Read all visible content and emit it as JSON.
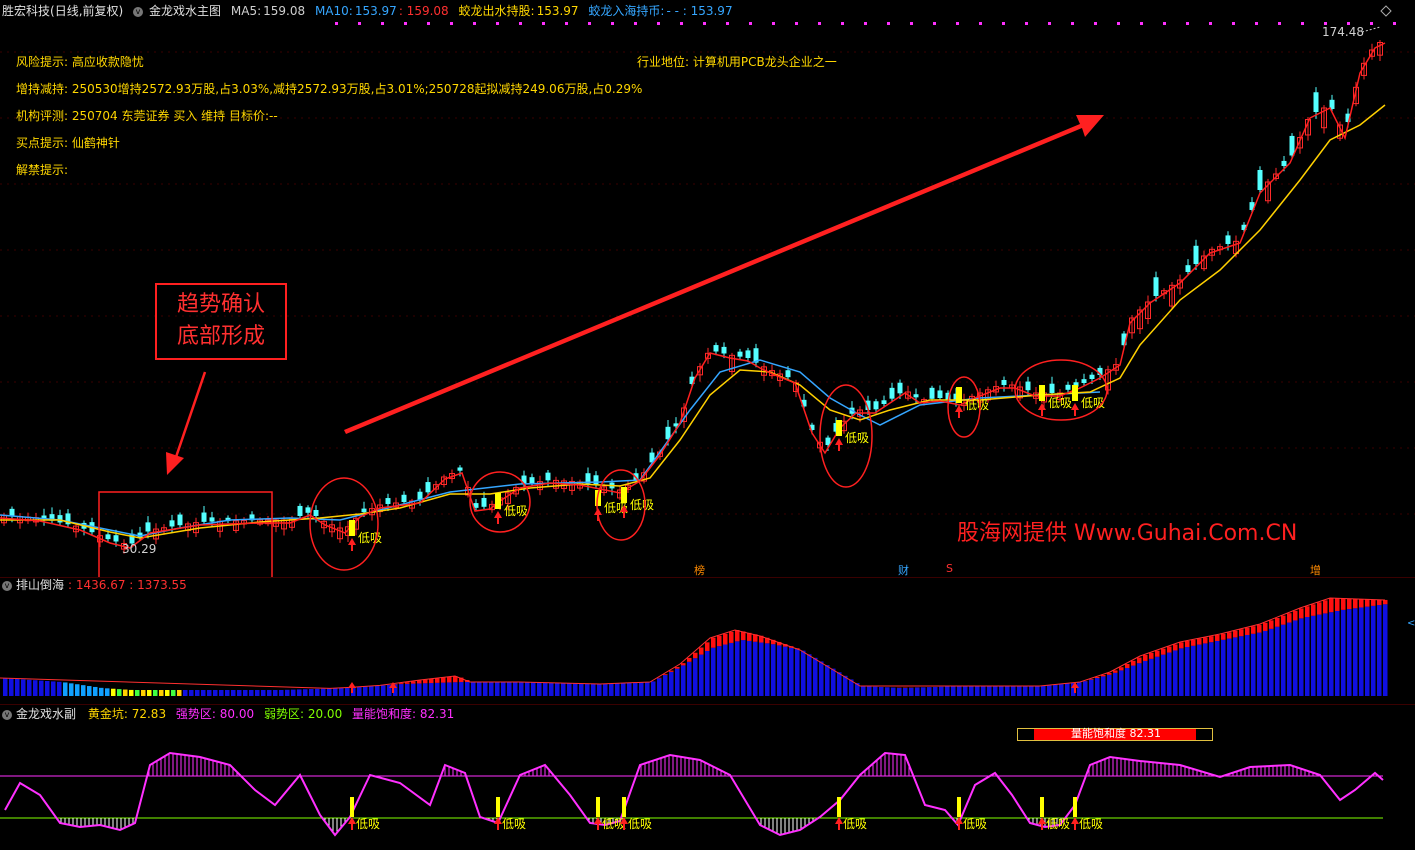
{
  "main": {
    "stock_name": "胜宏科技",
    "period": "(日线,前复权)",
    "indicator_name": "金龙戏水主图",
    "ma5_label": "MA5:",
    "ma5_value": "159.08",
    "ma10_label": "MA10:",
    "ma10_value": "153.97",
    "ma_extra_value": ": 159.08",
    "jl_label": "蛟龙出水持股:",
    "jl_value": "153.97",
    "jr_label": "蛟龙入海持币:",
    "jr_value": "- - : 153.97",
    "high_label": "174.48",
    "low_label": "30.29",
    "risk_key": "风险提示:",
    "risk_val": "高应收款隐忧",
    "hold_key": "增持减持:",
    "hold_val": "250530增持2572.93万股,占3.03%,减持2572.93万股,占3.01%;250728起拟减持249.06万股,占0.29%",
    "inst_key": "机构评测:",
    "inst_val": "250704 东莞证券 买入 维持 目标价:--",
    "buy_key": "买点提示:",
    "buy_val": "仙鹤神针",
    "unlock_key": "解禁提示:",
    "unlock_val": "",
    "industry_key": "行业地位:",
    "industry_val": "计算机用PCB龙头企业之一",
    "box_text_1": "趋势确认",
    "box_text_2": "底部形成",
    "watermark": "股海网提供 Www.Guhai.Com.CN",
    "low_buy": "低吸",
    "marker_bang": "榜",
    "marker_cai": "财",
    "marker_s": "S",
    "marker_zeng": "增",
    "colors": {
      "up": "#ff2a2a",
      "down": "#54ffff",
      "ma5": "#ff2020",
      "ma10": "#ffd000",
      "ma_blue": "#35a6ff",
      "magenta": "#ff30ff"
    }
  },
  "sub1": {
    "name": "排山倒海",
    "value": ": 1436.67 : 1373.55"
  },
  "sub2": {
    "name": "金龙戏水副",
    "gold_label": "黄金坑:",
    "gold_value": "72.83",
    "strong_label": "强势区:",
    "strong_value": "80.00",
    "weak_label": "弱势区:",
    "weak_value": "20.00",
    "energy_label": "量能饱和度:",
    "energy_value": "82.31",
    "energy_badge_label": "量能饱和度",
    "energy_badge_value": "82.31"
  }
}
